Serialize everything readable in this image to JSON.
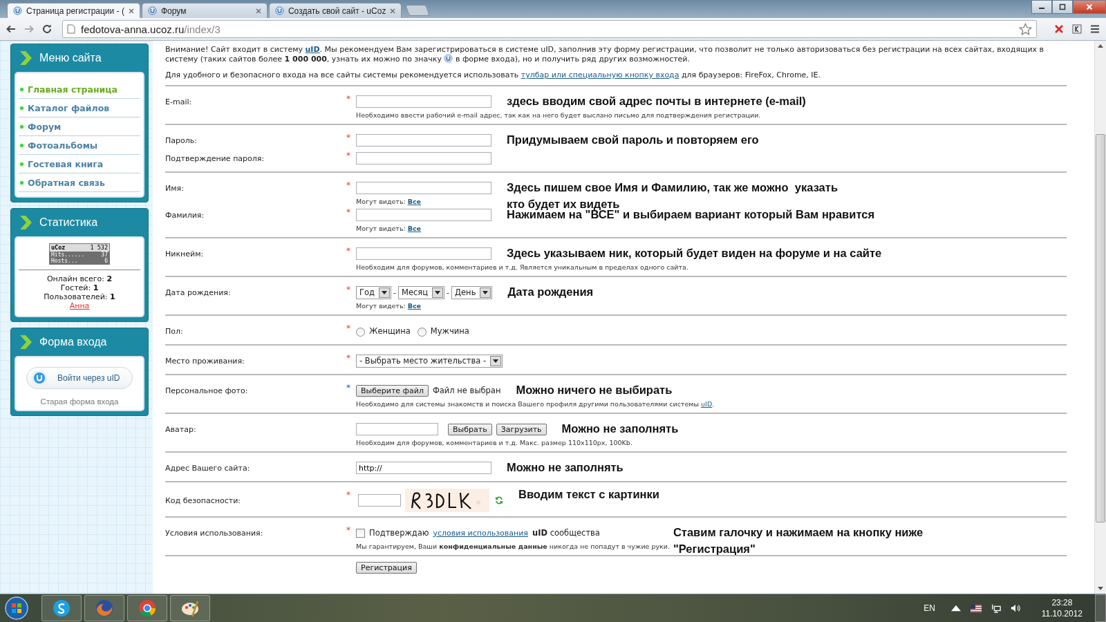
{
  "browser": {
    "tabs": [
      {
        "title": "Страница регистрации - (",
        "selected": true
      },
      {
        "title": "Форум",
        "selected": false
      },
      {
        "title": "Создать свой сайт - uCoz",
        "selected": false
      }
    ],
    "url": {
      "host": "fedotova-anna.ucoz.ru",
      "path": "/index/3"
    }
  },
  "sidebar": {
    "menu": {
      "title": "Меню сайта",
      "items": [
        {
          "label": "Главная страница",
          "selected": true
        },
        {
          "label": "Каталог файлов",
          "selected": false
        },
        {
          "label": "Форум",
          "selected": false
        },
        {
          "label": "Фотоальбомы",
          "selected": false
        },
        {
          "label": "Гостевая книга",
          "selected": false
        },
        {
          "label": "Обратная связь",
          "selected": false
        }
      ]
    },
    "stats": {
      "title": "Статистика",
      "counter": {
        "brand": "uCoz",
        "total": "1 532",
        "rows": [
          {
            "label": "Hits......",
            "value": "37"
          },
          {
            "label": "Hosts...",
            "value": "6"
          }
        ]
      },
      "lines": [
        {
          "label": "Онлайн всего:",
          "value": "2"
        },
        {
          "label": "Гостей:",
          "value": "1"
        },
        {
          "label": "Пользователей:",
          "value": "1"
        }
      ],
      "user": "Анна"
    },
    "login": {
      "title": "Форма входа",
      "button": "Войти через uID",
      "link": "Старая форма входа"
    }
  },
  "form": {
    "intro": [
      [
        {
          "kind": "text",
          "text": "Внимание! Сайт входит в систему "
        },
        {
          "kind": "link",
          "text": "uID"
        },
        {
          "kind": "text",
          "text": ". Мы рекомендуем Вам зарегистрироваться в системе uID, заполнив эту форму регистрации, что позволит не только авторизоваться без регистрации на всех сайтах, входящих в систему (таких сайтов более **1 000 000**, узнать их можно по значку "
        },
        {
          "kind": "icon"
        },
        {
          "kind": "text",
          "text": " в форме входа), но и получить ряд других возможностей."
        }
      ],
      [
        {
          "kind": "text",
          "text": "Для удобного и безопасного входа на все сайты системы рекомендуется использовать "
        },
        {
          "kind": "link",
          "text": "тулбар или специальную кнопку входа"
        },
        {
          "kind": "text",
          "text": " для браузеров: FireFox, Chrome, IE."
        }
      ]
    ],
    "sections": [
      {
        "lines": [
          {
            "label": "E-mail:",
            "asterisk": {
              "text": "*",
              "required": true
            },
            "controls": [
              {
                "kind": "input"
              }
            ],
            "note": "здесь вводим свой адрес почты в интернете (e-mail)"
          }
        ],
        "hint": [
          {
            "kind": "text",
            "text": "Необходимо ввести рабочий e-mail адрес, так как на него будет выслано письмо для подтверждения регистрации."
          }
        ]
      },
      {
        "lines": [
          {
            "label": "Пароль:",
            "asterisk": {
              "text": "*",
              "required": true
            },
            "controls": [
              {
                "kind": "input"
              }
            ],
            "note": "Придумываем свой пароль и повторяем его"
          },
          {
            "label": "Подтверждение пароля:",
            "asterisk": {
              "text": "*",
              "required": true
            },
            "controls": [
              {
                "kind": "input"
              }
            ]
          }
        ]
      },
      {
        "lines": [
          {
            "label": "Имя:",
            "asterisk": {
              "text": "*",
              "required": true
            },
            "controls": [
              {
                "kind": "input"
              }
            ],
            "note": "Здесь пишем свое Имя и Фамилию, так же можно  указать\nкто будет их видеть",
            "visibility": {
              "label": "Могут видеть:",
              "link": "Все"
            }
          },
          {
            "label": "Фамилия:",
            "asterisk": {
              "text": "*",
              "required": true
            },
            "controls": [
              {
                "kind": "input"
              }
            ],
            "note": "Нажимаем на \"ВСЕ\" и выбираем вариант который Вам нравится",
            "visibility": {
              "label": "Могут видеть:",
              "link": "Все"
            }
          }
        ]
      },
      {
        "lines": [
          {
            "label": "Никнейм:",
            "asterisk": {
              "text": "*",
              "required": true
            },
            "controls": [
              {
                "kind": "input"
              }
            ],
            "note": "Здесь указываем ник, который будет виден на форуме и на сайте"
          }
        ],
        "hint": [
          {
            "kind": "text",
            "text": "Необходим для форумов, комментариев и т.д. Является уникальным в пределах одного сайта."
          }
        ]
      },
      {
        "lines": [
          {
            "label": "Дата рождения:",
            "asterisk": {
              "text": "*",
              "required": true
            },
            "controls": [
              {
                "kind": "select",
                "text": "Год"
              },
              {
                "kind": "dash",
                "text": "-"
              },
              {
                "kind": "select",
                "text": "Месяц"
              },
              {
                "kind": "dash",
                "text": "-"
              },
              {
                "kind": "select",
                "text": "День"
              }
            ],
            "note": "Дата рождения",
            "visibility": {
              "label": "Могут видеть:",
              "link": "Все"
            }
          }
        ]
      },
      {
        "lines": [
          {
            "label": "Пол:",
            "asterisk": {
              "text": "*",
              "required": true
            },
            "controls": [
              {
                "kind": "radio",
                "text": "Женщина",
                "checked": false
              },
              {
                "kind": "radio",
                "text": "Мужчина",
                "checked": false
              }
            ]
          }
        ]
      },
      {
        "lines": [
          {
            "label": "Место проживания:",
            "asterisk": {
              "text": "*",
              "required": true
            },
            "controls": [
              {
                "kind": "select",
                "text": "- Выбрать место жительства -"
              }
            ]
          }
        ]
      },
      {
        "lines": [
          {
            "label": "Персональное фото:",
            "asterisk": {
              "text": "*",
              "required": false
            },
            "controls": [
              {
                "kind": "button",
                "text": "Выберите файл"
              },
              {
                "kind": "text",
                "text": "Файл не выбран"
              }
            ],
            "note": "Можно ничего не выбирать"
          }
        ],
        "hint": [
          {
            "kind": "text",
            "text": "Необходимо для системы знакомств и поиска Вашего профиля другими пользователями системы "
          },
          {
            "kind": "link",
            "text": "uID"
          },
          {
            "kind": "text",
            "text": "."
          }
        ]
      },
      {
        "lines": [
          {
            "label": "Аватар:",
            "controls": [
              {
                "kind": "short-input"
              },
              {
                "kind": "button",
                "text": "Выбрать"
              },
              {
                "kind": "button",
                "text": "Загрузить"
              }
            ],
            "note": "Можно не заполнять"
          }
        ],
        "hint": [
          {
            "kind": "text",
            "text": "Необходим для форумов, комментариев и т.д. Макс. размер 110x110px, 100Kb."
          }
        ]
      },
      {
        "lines": [
          {
            "label": "Адрес Вашего сайта:",
            "controls": [
              {
                "kind": "input",
                "value": "http://"
              }
            ],
            "note": "Можно не заполнять"
          }
        ]
      },
      {
        "lines": [
          {
            "label": "Код безопасности:",
            "asterisk": {
              "text": "*",
              "required": true
            },
            "controls": [
              {
                "kind": "code-input"
              },
              {
                "kind": "captcha"
              },
              {
                "kind": "refresh"
              }
            ],
            "note": "Вводим текст с картинки"
          }
        ]
      },
      {
        "lines": [
          {
            "label": "Условия использования:",
            "asterisk": {
              "text": "*",
              "required": true
            },
            "controls": [
              {
                "kind": "checkbox",
                "checked": false
              },
              {
                "kind": "text",
                "text": "Подтверждаю"
              },
              {
                "kind": "link",
                "text": "условия использования"
              },
              {
                "kind": "text",
                "text": "**uID** сообщества"
              }
            ],
            "note": "Ставим галочку и нажимаем на кнопку ниже\n\"Регистрация\""
          }
        ],
        "hint": [
          {
            "kind": "text",
            "text": "Мы гарантируем, Ваши **конфиденциальные данные** никогда не попадут в чужие руки."
          }
        ]
      }
    ],
    "submit": "Регистрация"
  },
  "taskbar": {
    "language": "EN",
    "time": "23:28",
    "date": "11.10.2012"
  }
}
